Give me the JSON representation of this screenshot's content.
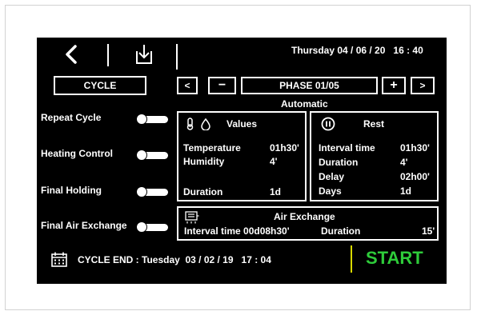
{
  "header": {
    "datetime": "Thursday 04 / 06 / 20   16 : 40"
  },
  "cycle_button": "CYCLE",
  "phase": {
    "prev": "<",
    "minus": "−",
    "label": "PHASE 01/05",
    "plus": "+",
    "next": ">"
  },
  "mode": "Automatic",
  "toggles": [
    {
      "label": "Repeat Cycle"
    },
    {
      "label": "Heating Control"
    },
    {
      "label": "Final Holding"
    },
    {
      "label": "Final Air Exchange"
    }
  ],
  "values_panel": {
    "title": "Values",
    "rows": [
      {
        "label": "Temperature",
        "value": "01h30'"
      },
      {
        "label": "Humidity",
        "value": "4'"
      },
      {
        "label": "Duration",
        "value": "1d"
      }
    ]
  },
  "rest_panel": {
    "title": "Rest",
    "rows": [
      {
        "label": "Interval time",
        "value": "01h30'"
      },
      {
        "label": "Duration",
        "value": "4'"
      },
      {
        "label": "Delay",
        "value": "02h00'"
      },
      {
        "label": "Days",
        "value": "1d"
      }
    ]
  },
  "air_panel": {
    "title": "Air Exchange",
    "interval": "Interval time 00d08h30'",
    "duration_label": "Duration",
    "duration_value": "15'"
  },
  "footer": {
    "cycle_end": "CYCLE END : Tuesday  03 / 02 / 19   17 : 04",
    "start": "START",
    "start_color": "#2ecc3a"
  }
}
